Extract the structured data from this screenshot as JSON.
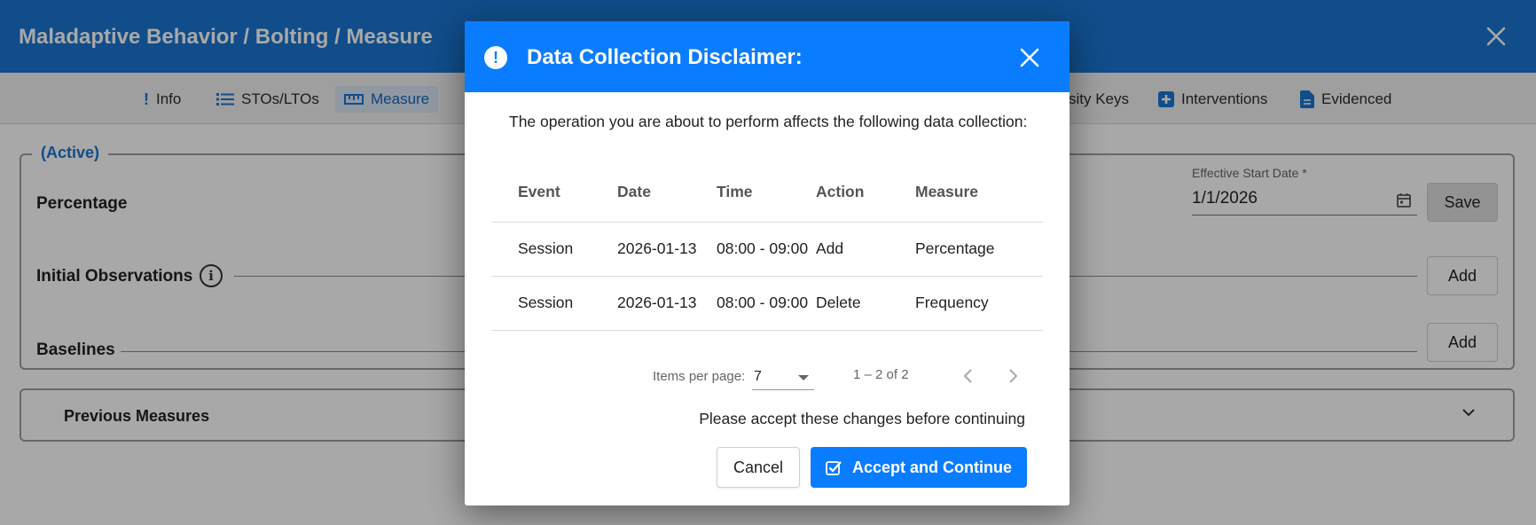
{
  "background": {
    "header_title": "Maladaptive Behavior / Bolting / Measure",
    "tabs": [
      {
        "label": "Info",
        "icon": "exclamation-icon"
      },
      {
        "label": "STOs/LTOs",
        "icon": "list-icon"
      },
      {
        "label": "Measure",
        "icon": "ruler-icon",
        "active": true
      },
      {
        "label": "sity Keys",
        "icon": "key-icon"
      },
      {
        "label": "Interventions",
        "icon": "plus-square-icon"
      },
      {
        "label": "Evidenced",
        "icon": "document-icon"
      }
    ],
    "status_legend": "(Active)",
    "measure_type": "Percentage",
    "initial_observations_label": "Initial Observations",
    "baselines_label": "Baselines",
    "effective_start_label": "Effective Start Date *",
    "effective_start_value": "1/1/2026",
    "save_label": "Save",
    "add_label": "Add",
    "previous_measures_label": "Previous Measures"
  },
  "dialog": {
    "title": "Data Collection Disclaimer:",
    "intro": "The operation you are about to perform affects the following data collection:",
    "columns": [
      "Event",
      "Date",
      "Time",
      "Action",
      "Measure"
    ],
    "rows": [
      {
        "event": "Session",
        "date": "2026-01-13",
        "time": "08:00 - 09:00",
        "action": "Add",
        "measure": "Percentage"
      },
      {
        "event": "Session",
        "date": "2026-01-13",
        "time": "08:00 - 09:00",
        "action": "Delete",
        "measure": "Frequency"
      }
    ],
    "paginator": {
      "items_per_page_label": "Items per page:",
      "items_per_page_value": "7",
      "range_label": "1 – 2 of 2"
    },
    "accept_message": "Please accept these changes before continuing",
    "cancel_label": "Cancel",
    "accept_label": "Accept and Continue"
  },
  "colors": {
    "header_blue": "#1976d2",
    "dialog_blue": "#0a7cff"
  }
}
